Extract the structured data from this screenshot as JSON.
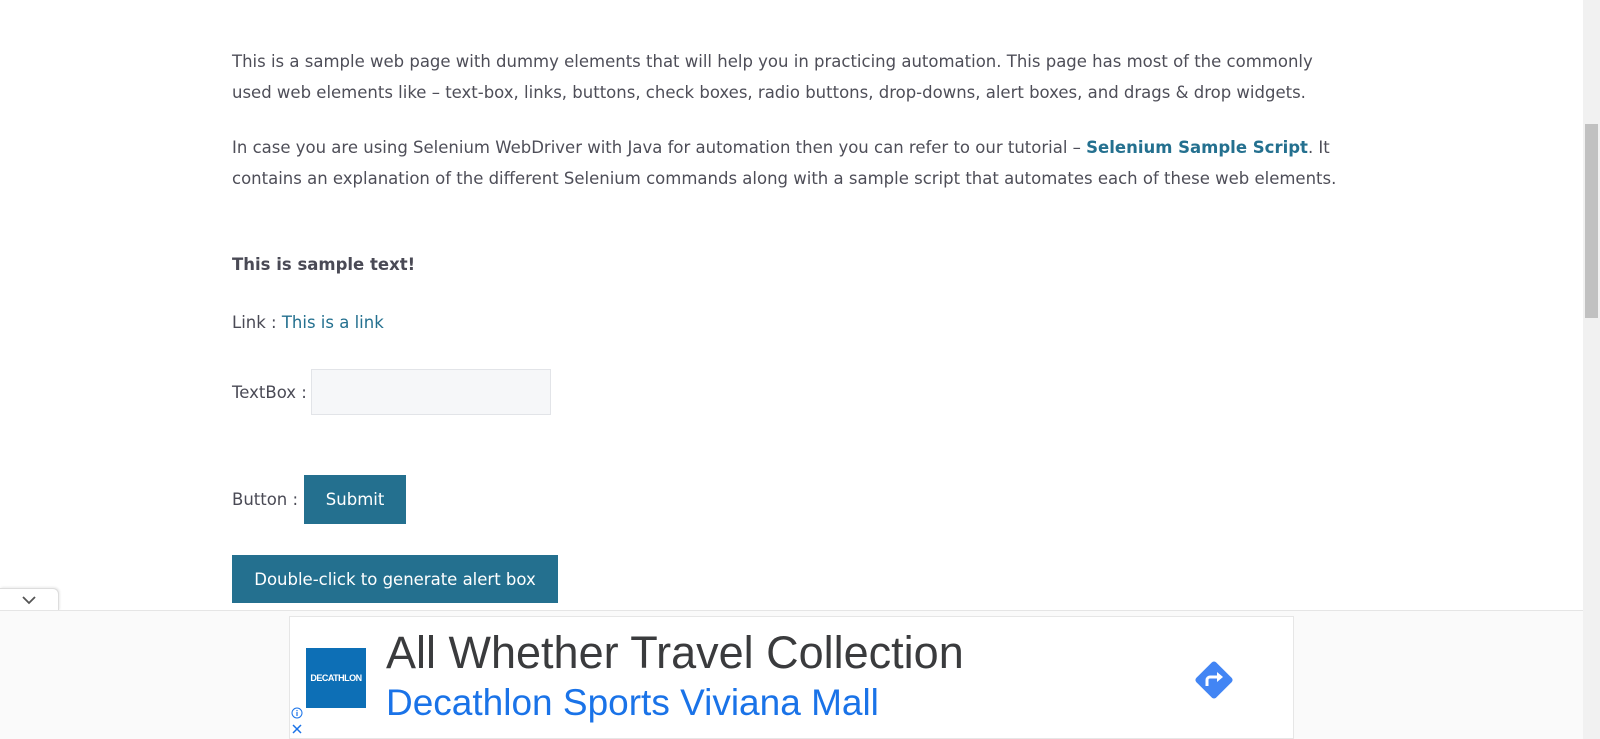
{
  "intro": {
    "para1": "This is a sample web page with dummy elements that will help you in practicing automation. This page has most of the commonly used web elements like – text-box, links, buttons, check boxes, radio buttons, drop-downs, alert boxes, and drags & drop widgets.",
    "para2_before": "In case you are using Selenium WebDriver with Java for automation then you can refer to our tutorial – ",
    "para2_link": "Selenium Sample Script",
    "para2_after": ". It contains an explanation of the different Selenium commands along with a sample script that automates each of these web elements."
  },
  "sample_text": "This is sample text!",
  "link_row": {
    "label": "Link : ",
    "link_text": "This is a link"
  },
  "textbox_row": {
    "label": "TextBox :",
    "value": "",
    "placeholder": ""
  },
  "button_row": {
    "label": "Button :",
    "submit_label": "Submit"
  },
  "double_click_button": {
    "label": "Double-click to generate alert box"
  },
  "ad": {
    "logo_text": "DECATHLON",
    "headline": "All Whether Travel Collection",
    "subline": "Decathlon Sports Viviana Mall",
    "icons": [
      "chevron-down-icon",
      "directions-icon",
      "info-icon",
      "close-icon"
    ],
    "colors": {
      "logo_bg": "#0d6fb6",
      "subline": "#1a73e8",
      "directions": "#4285f4"
    }
  },
  "theme": {
    "accent": "#24708f",
    "text": "#4e4e58"
  }
}
